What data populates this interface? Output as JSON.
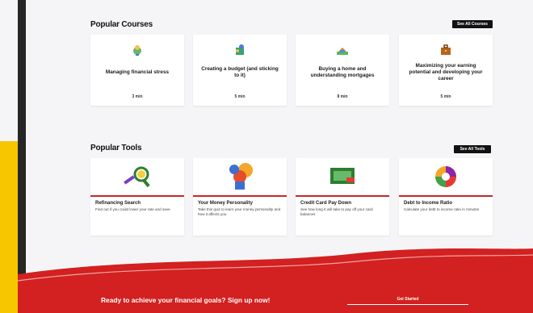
{
  "courses_section": {
    "title": "Popular Courses",
    "see_all": "See All Courses",
    "items": [
      {
        "title": "Managing financial stress",
        "meta": "3 min",
        "icon": "piggy-bank-icon"
      },
      {
        "title": "Creating a budget (and sticking to it)",
        "meta": "5 min",
        "icon": "budget-icon"
      },
      {
        "title": "Buying a home and understanding mortgages",
        "meta": "8 min",
        "icon": "house-icon"
      },
      {
        "title": "Maximizing your earning potential and developing your career",
        "meta": "5 min",
        "icon": "briefcase-icon"
      }
    ]
  },
  "tools_section": {
    "title": "Popular Tools",
    "see_all": "See All Tools",
    "items": [
      {
        "name": "Refinancing Search",
        "desc": "Find out if you could lower your rate and save",
        "icon": "magnifier-icon"
      },
      {
        "name": "Your Money Personality",
        "desc": "Take this quiz to learn your money personality and how it affects you",
        "icon": "money-personality-icon"
      },
      {
        "name": "Credit Card Pay Down",
        "desc": "See how long it will take to pay off your card balances",
        "icon": "credit-card-icon"
      },
      {
        "name": "Debt to Income Ratio",
        "desc": "Calculate your debt to income ratio in minutes",
        "icon": "pie-chart-icon"
      }
    ]
  },
  "footer": {
    "cta_text": "Ready to achieve your financial goals? Sign up now!",
    "button_label": "Get Started"
  },
  "colors": {
    "accent_red": "#d32020",
    "accent_yellow": "#f7c600",
    "dark": "#111111"
  }
}
